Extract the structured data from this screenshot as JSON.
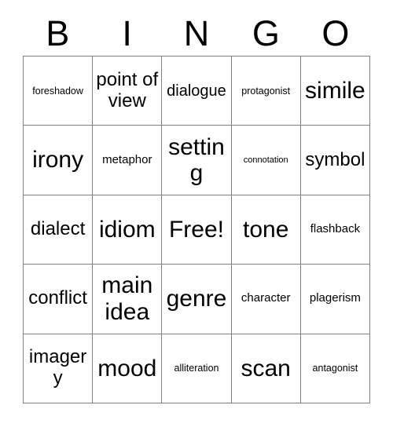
{
  "card": {
    "title": "BINGO",
    "background_color": "#ffffff",
    "text_color": "#000000",
    "border_color": "#808080"
  },
  "header": {
    "letters": [
      "B",
      "I",
      "N",
      "G",
      "O"
    ]
  },
  "grid": {
    "columns": 5,
    "rows": 5,
    "free_space_label": "Free!",
    "free_space_position": {
      "row": 3,
      "column": 3
    },
    "cells": [
      [
        {
          "label": "foreshadow",
          "size": "sm"
        },
        {
          "label": "point of view",
          "size": "xl"
        },
        {
          "label": "dialogue",
          "size": "lg"
        },
        {
          "label": "protagonist",
          "size": "sm"
        },
        {
          "label": "simile",
          "size": "xxl"
        }
      ],
      [
        {
          "label": "irony",
          "size": "xxl"
        },
        {
          "label": "metaphor",
          "size": "md"
        },
        {
          "label": "setting",
          "size": "xxl"
        },
        {
          "label": "connotation",
          "size": "xs"
        },
        {
          "label": "symbol",
          "size": "xl"
        }
      ],
      [
        {
          "label": "dialect",
          "size": "xl"
        },
        {
          "label": "idiom",
          "size": "xxl"
        },
        {
          "label": "Free!",
          "size": "xxl"
        },
        {
          "label": "tone",
          "size": "xxl"
        },
        {
          "label": "flashback",
          "size": "md"
        }
      ],
      [
        {
          "label": "conflict",
          "size": "xl"
        },
        {
          "label": "main idea",
          "size": "xxl"
        },
        {
          "label": "genre",
          "size": "xxl"
        },
        {
          "label": "character",
          "size": "md"
        },
        {
          "label": "plagerism",
          "size": "md"
        }
      ],
      [
        {
          "label": "imagery",
          "size": "xl"
        },
        {
          "label": "mood",
          "size": "xxl"
        },
        {
          "label": "alliteration",
          "size": "sm"
        },
        {
          "label": "scan",
          "size": "xxl"
        },
        {
          "label": "antagonist",
          "size": "sm"
        }
      ]
    ]
  }
}
